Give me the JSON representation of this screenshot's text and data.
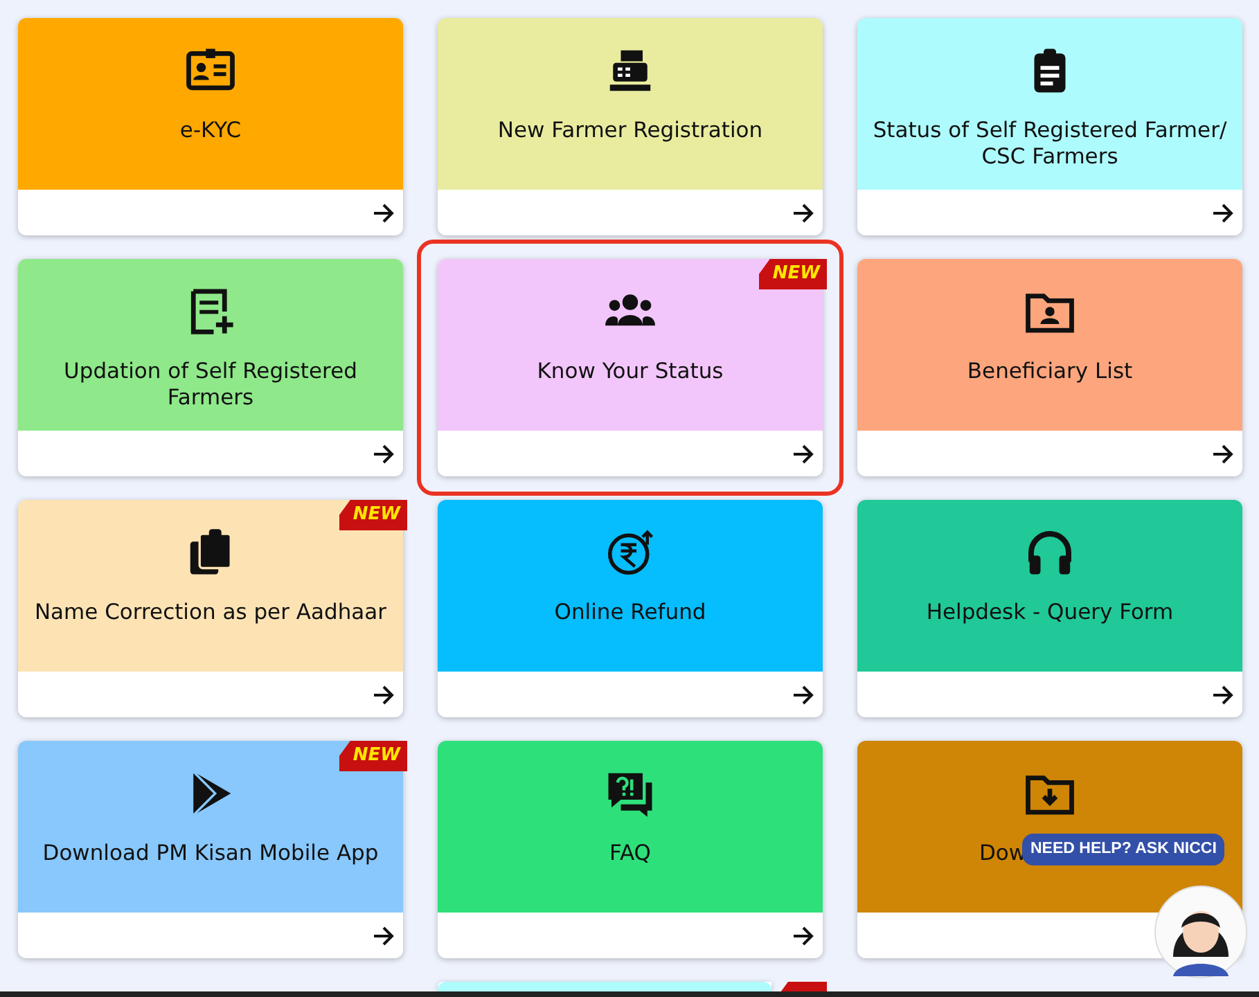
{
  "cards": [
    {
      "title": "e-KYC",
      "color": "#ffa800",
      "new": false,
      "highlighted": false
    },
    {
      "title": "New Farmer Registration",
      "color": "#e9ec9f",
      "new": false,
      "highlighted": false
    },
    {
      "title": "Status of Self Registered Farmer/ CSC Farmers",
      "color": "#aefbfd",
      "new": false,
      "highlighted": false
    },
    {
      "title": "Updation of Self Registered Farmers",
      "color": "#8fe88a",
      "new": false,
      "highlighted": false
    },
    {
      "title": "Know Your Status",
      "color": "#f3c6fb",
      "new": true,
      "badge_text": "NEW",
      "highlighted": true
    },
    {
      "title": "Beneficiary List",
      "color": "#fda57d",
      "new": false,
      "highlighted": false
    },
    {
      "title": "Name Correction as per Aadhaar",
      "color": "#fde3b4",
      "new": true,
      "badge_text": "NEW",
      "highlighted": false
    },
    {
      "title": "Online Refund",
      "color": "#06bdfd",
      "new": false,
      "highlighted": false
    },
    {
      "title": "Helpdesk - Query Form",
      "color": "#20c997",
      "new": false,
      "highlighted": false
    },
    {
      "title": "Download PM Kisan Mobile App",
      "color": "#88c8fc",
      "new": true,
      "badge_text": "NEW",
      "highlighted": false
    },
    {
      "title": "FAQ",
      "color": "#2ee07a",
      "new": false,
      "highlighted": false
    },
    {
      "title": "Dow",
      "color": "#cf8505",
      "new": false,
      "highlighted": false
    },
    {
      "color": "#aefbfd",
      "new": true,
      "highlighted": false
    }
  ],
  "chat": {
    "bubble": "NEED HELP? ASK NICCI"
  }
}
